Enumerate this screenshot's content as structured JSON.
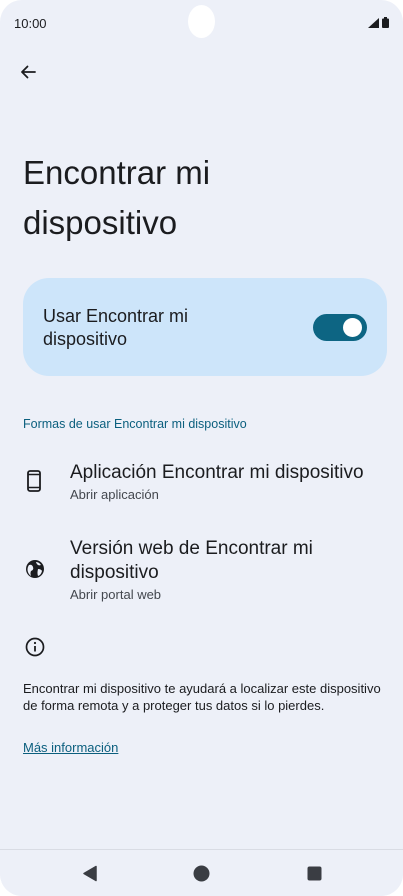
{
  "status_bar": {
    "time": "10:00"
  },
  "header": {
    "title": "Encontrar mi dispositivo"
  },
  "main_switch": {
    "label": "Usar Encontrar mi dispositivo",
    "enabled": true,
    "track_color": "#0d6583",
    "card_color": "#cde5fa"
  },
  "section": {
    "header": "Formas de usar Encontrar mi dispositivo"
  },
  "items": [
    {
      "title": "Aplicación Encontrar mi dispositivo",
      "subtitle": "Abrir aplicación",
      "icon": "phone-icon"
    },
    {
      "title": "Versión web de Encontrar mi dispositivo",
      "subtitle": "Abrir portal web",
      "icon": "globe-icon"
    }
  ],
  "footer": {
    "text": "Encontrar mi dispositivo te ayudará a localizar este dispositivo de forma remota y a proteger tus datos si lo pierdes.",
    "link": "Más información",
    "icon": "info-icon"
  },
  "colors": {
    "background": "#edf0f8",
    "accent": "#0b5f7e"
  }
}
